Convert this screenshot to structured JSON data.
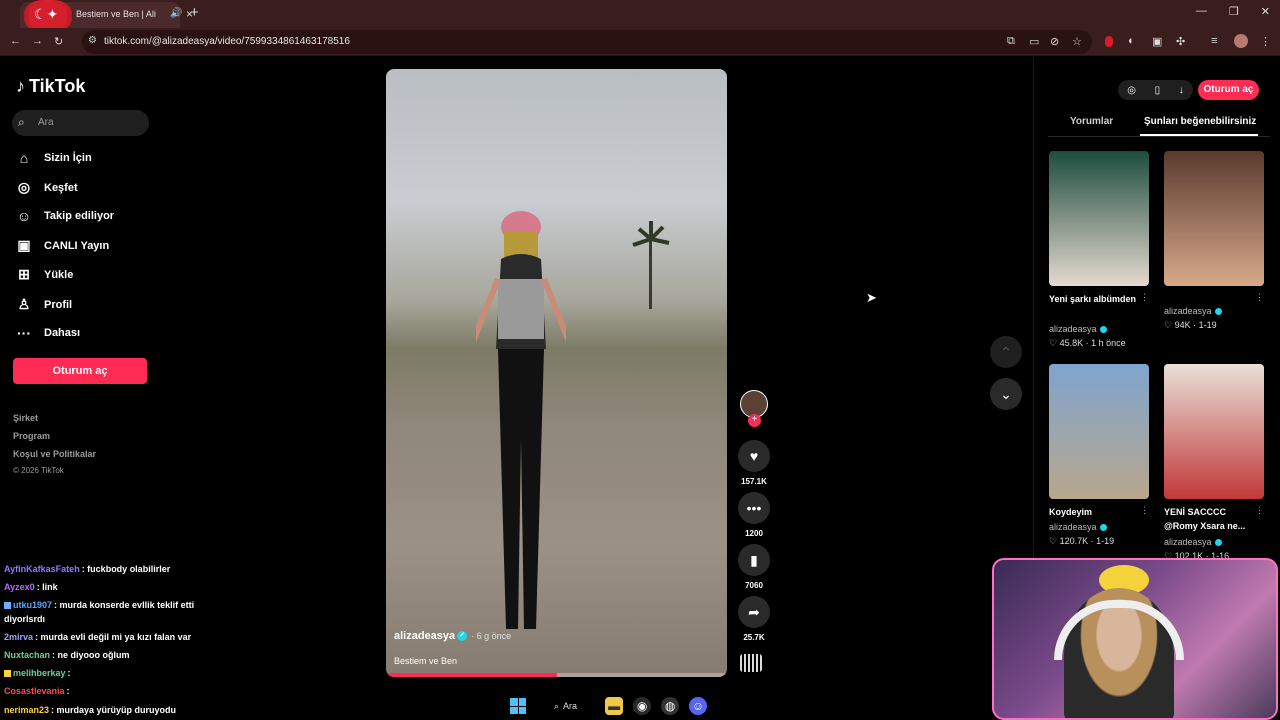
{
  "browser": {
    "tab_title": "Bestiem ve Ben | Alizade | TikTok",
    "url": "tiktok.com/@alizadeasya/video/7599334861463178516",
    "new_tab": "+",
    "tab_close": "×"
  },
  "tiktok": {
    "logo": "TikTok",
    "search_placeholder": "Ara",
    "nav": [
      {
        "label": "Sizin İçin",
        "icon": "home-icon"
      },
      {
        "label": "Keşfet",
        "icon": "compass-icon"
      },
      {
        "label": "Takip ediliyor",
        "icon": "person-icon"
      },
      {
        "label": "CANLI Yayın",
        "icon": "live-icon"
      },
      {
        "label": "Yükle",
        "icon": "upload-icon"
      },
      {
        "label": "Profil",
        "icon": "profile-icon"
      },
      {
        "label": "Dahası",
        "icon": "more-icon"
      }
    ],
    "login_button": "Oturum aç",
    "footer": [
      "Şirket",
      "Program",
      "Koşul ve Politikalar"
    ],
    "copyright": "© 2026 TikTok"
  },
  "chat": [
    {
      "user": "AyfinKafkasFateh",
      "text": ": fuckbody olabilirler",
      "color": "#8a7bff"
    },
    {
      "user": "Ayzex0",
      "text": ": link",
      "color": "#b86bff"
    },
    {
      "user": "utku1907",
      "text": ": murda konserde evllik teklif etti",
      "color": "#5aa7ff"
    },
    {
      "user": "",
      "text": "diyorlsrdı",
      "color": "#ffffff"
    },
    {
      "user": "2mirva",
      "text": ": murda evli değil mi ya kızı falan var",
      "color": "#9aa4ff"
    },
    {
      "user": "Nuxtachan",
      "text": ": ne diyooo oğlum",
      "color": "#6bd18a"
    },
    {
      "user": "melihberkay",
      "text": ":",
      "color": "#6bd18a"
    },
    {
      "user": "Cosastlevania",
      "text": ":",
      "color": "#ff4a4a"
    },
    {
      "user": "neriman23",
      "text": ": murdaya yürüyüp duruyodu",
      "color": "#ffd23a"
    }
  ],
  "video": {
    "author": "alizadeasya",
    "verified_mark": "✓",
    "time": "· 6 g önce",
    "description": "Bestiem ve Ben",
    "progress": 0.5
  },
  "actions": {
    "follow": "+",
    "likes": "157.1K",
    "comments": "1200",
    "saves": "7060",
    "shares": "25.7K"
  },
  "right_panel": {
    "login_button": "Oturum aç",
    "tab_comments": "Yorumlar",
    "tab_suggestions": "Şunları beğenebilirsiniz",
    "cards": [
      {
        "title": "Yeni şarkı albümden",
        "author": "alizadeasya",
        "likes": "45.8K",
        "time": "1 h önce",
        "colors": [
          "#1d4c3e",
          "#e6d9cf"
        ]
      },
      {
        "title": "",
        "author": "alizadeasya",
        "likes": "94K",
        "time": "1-19",
        "colors": [
          "#5a3a2e",
          "#d8a98a"
        ]
      },
      {
        "title": "Koydeyim",
        "author": "alizadeasya",
        "likes": "120.7K",
        "time": "1-19",
        "colors": [
          "#7fa4cf",
          "#b8a78d"
        ]
      },
      {
        "title": "YENİ SACCCC @Romy Xsara ne...",
        "author": "alizadeasya",
        "likes": "102.1K",
        "time": "1-16",
        "colors": [
          "#e8e0d8",
          "#c2383a"
        ]
      }
    ]
  },
  "taskbar": {
    "search_label": "Ara"
  }
}
